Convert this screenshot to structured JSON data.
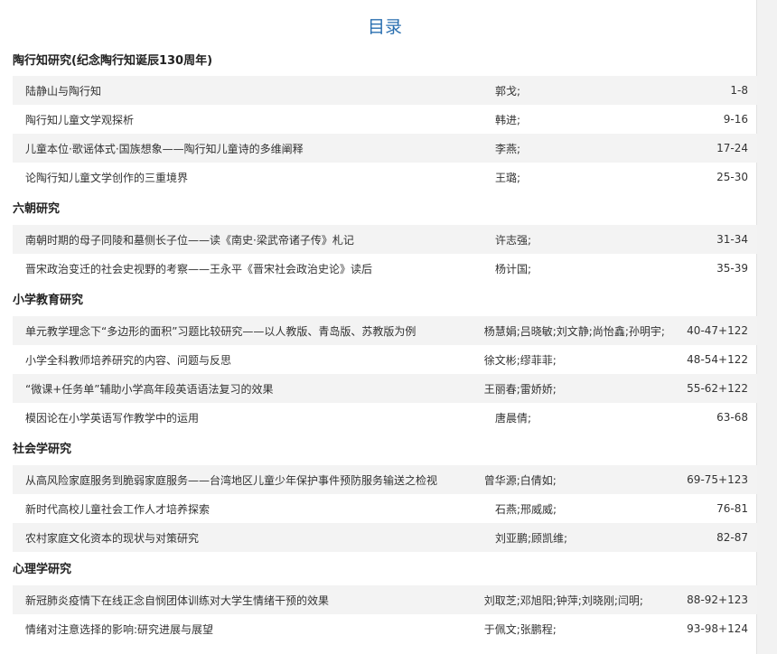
{
  "page_title": "目录",
  "sections": [
    {
      "title": "陶行知研究(纪念陶行知诞辰130周年)",
      "items": [
        {
          "title": "陆静山与陶行知",
          "authors": "郭戈;",
          "pages": "1-8"
        },
        {
          "title": "陶行知儿童文学观探析",
          "authors": "韩进;",
          "pages": "9-16"
        },
        {
          "title": "儿童本位·歌谣体式·国族想象——陶行知儿童诗的多维阐释",
          "authors": "李燕;",
          "pages": "17-24"
        },
        {
          "title": "论陶行知儿童文学创作的三重境界",
          "authors": "王璐;",
          "pages": "25-30"
        }
      ]
    },
    {
      "title": "六朝研究",
      "items": [
        {
          "title": "南朝时期的母子同陵和墓侧长子位——读《南史·梁武帝诸子传》札记",
          "authors": "许志强;",
          "pages": "31-34"
        },
        {
          "title": "晋宋政治变迁的社会史视野的考察——王永平《晋宋社会政治史论》读后",
          "authors": "杨计国;",
          "pages": "35-39"
        }
      ]
    },
    {
      "title": "小学教育研究",
      "items": [
        {
          "title": "单元教学理念下“多边形的面积”习题比较研究——以人教版、青岛版、苏教版为例",
          "authors": "杨慧娟;吕晓敏;刘文静;尚怡鑫;孙明宇;",
          "pages": "40-47+122"
        },
        {
          "title": "小学全科教师培养研究的内容、问题与反思",
          "authors": "徐文彬;缪菲菲;",
          "pages": "48-54+122"
        },
        {
          "title": "“微课+任务单”辅助小学高年段英语语法复习的效果",
          "authors": "王丽春;雷娇娇;",
          "pages": "55-62+122"
        },
        {
          "title": "模因论在小学英语写作教学中的运用",
          "authors": "唐晨倩;",
          "pages": "63-68"
        }
      ]
    },
    {
      "title": "社会学研究",
      "items": [
        {
          "title": "从高风险家庭服务到脆弱家庭服务——台湾地区儿童少年保护事件预防服务输送之检视",
          "authors": "曾华源;白倩如;",
          "pages": "69-75+123"
        },
        {
          "title": "新时代高校儿童社会工作人才培养探索",
          "authors": "石燕;邢威威;",
          "pages": "76-81"
        },
        {
          "title": "农村家庭文化资本的现状与对策研究",
          "authors": "刘亚鹏;顾凯维;",
          "pages": "82-87"
        }
      ]
    },
    {
      "title": "心理学研究",
      "items": [
        {
          "title": "新冠肺炎疫情下在线正念自悯团体训练对大学生情绪干预的效果",
          "authors": "刘取芝;邓旭阳;钟萍;刘晓刚;闫明;",
          "pages": "88-92+123"
        },
        {
          "title": "情绪对注意选择的影响:研究进展与展望",
          "authors": "于佩文;张鹏程;",
          "pages": "93-98+124"
        }
      ]
    }
  ]
}
